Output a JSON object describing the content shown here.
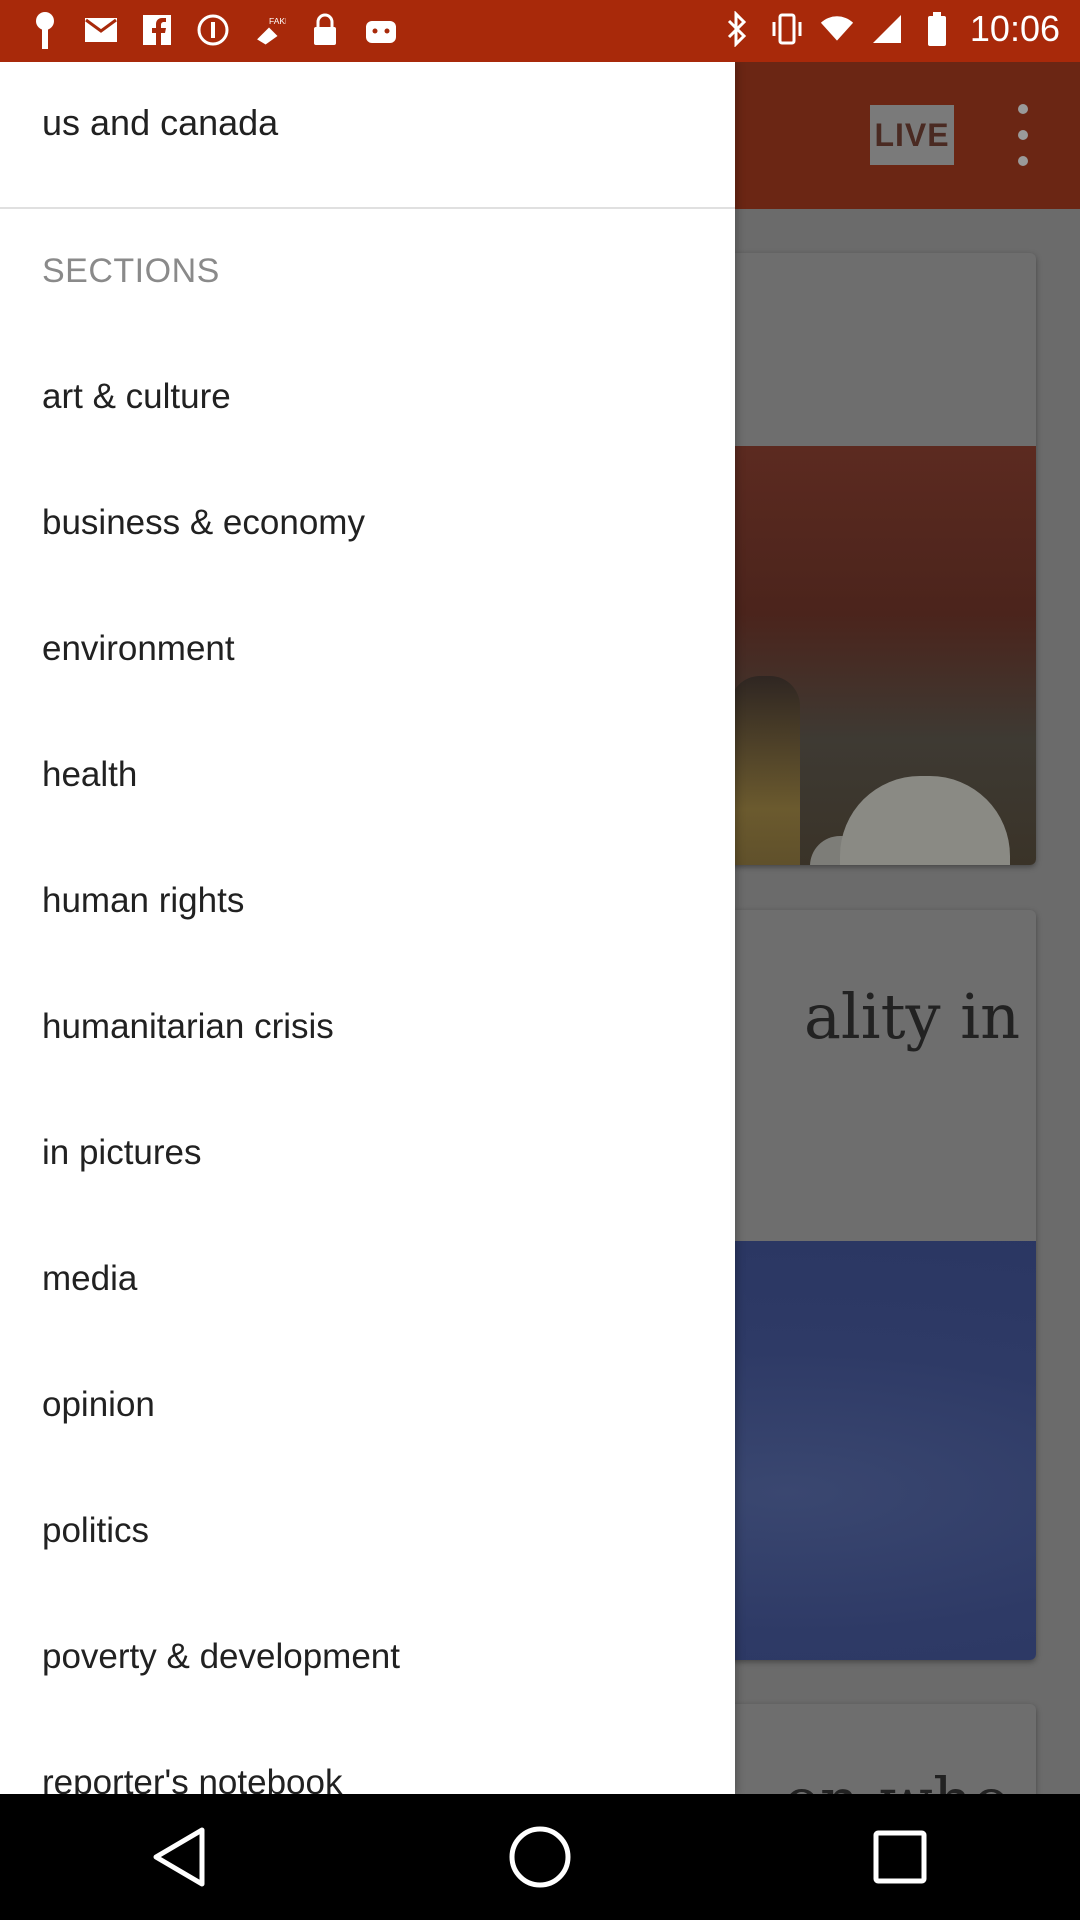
{
  "status_bar": {
    "time": "10:06",
    "left_icons": [
      "antenna-icon",
      "mail-icon",
      "facebook-icon",
      "circle-icon",
      "fake-gps-icon",
      "lock-icon",
      "android-icon"
    ],
    "right_icons": [
      "bluetooth-icon",
      "vibrate-icon",
      "wifi-icon",
      "signal-icon",
      "battery-icon"
    ]
  },
  "app_bar": {
    "live_label": "LIVE",
    "overflow_icon": "more-vert-icon",
    "accent_color": "#a8290a"
  },
  "background_cards": [
    {
      "headline_fragment": ""
    },
    {
      "headline_fragment": "ality in"
    },
    {
      "headline_fragment": "en who"
    }
  ],
  "drawer": {
    "region": "us and canada",
    "section_title": "SECTIONS",
    "items": [
      {
        "label": "art & culture"
      },
      {
        "label": "business & economy"
      },
      {
        "label": "environment"
      },
      {
        "label": "health"
      },
      {
        "label": "human rights"
      },
      {
        "label": "humanitarian crisis"
      },
      {
        "label": "in pictures"
      },
      {
        "label": "media"
      },
      {
        "label": "opinion"
      },
      {
        "label": "politics"
      },
      {
        "label": "poverty & development"
      },
      {
        "label": "reporter's notebook"
      }
    ]
  },
  "nav_bar": {
    "buttons": [
      "back-icon",
      "home-icon",
      "recents-icon"
    ]
  }
}
